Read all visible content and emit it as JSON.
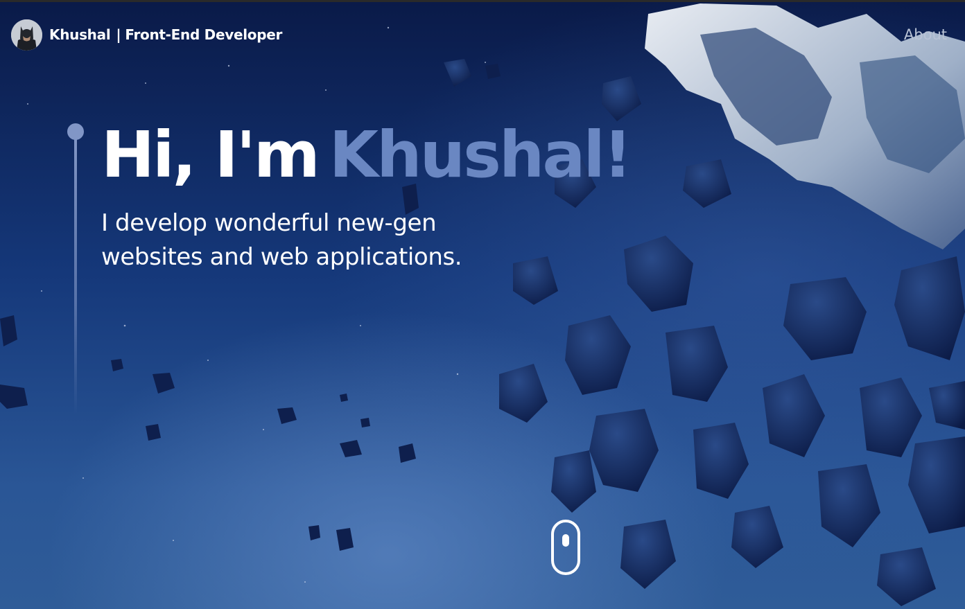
{
  "header": {
    "brand_name": "Khushal",
    "brand_separator": "|",
    "brand_role": "Front-End Developer",
    "avatar_icon": "batman-avatar-icon",
    "nav": [
      {
        "label": "About"
      }
    ]
  },
  "hero": {
    "greeting": "Hi, I'm",
    "name": "Khushal!",
    "subtitle_line1": "I develop wonderful new-gen",
    "subtitle_line2": "websites and web applications."
  },
  "scroll_indicator": {
    "icon": "mouse-scroll-icon"
  },
  "colors": {
    "accent": "#6a87c2",
    "timeline": "#8196c6",
    "background": "#15387a",
    "text": "#ffffff",
    "nav_text": "#b9c3d6"
  }
}
